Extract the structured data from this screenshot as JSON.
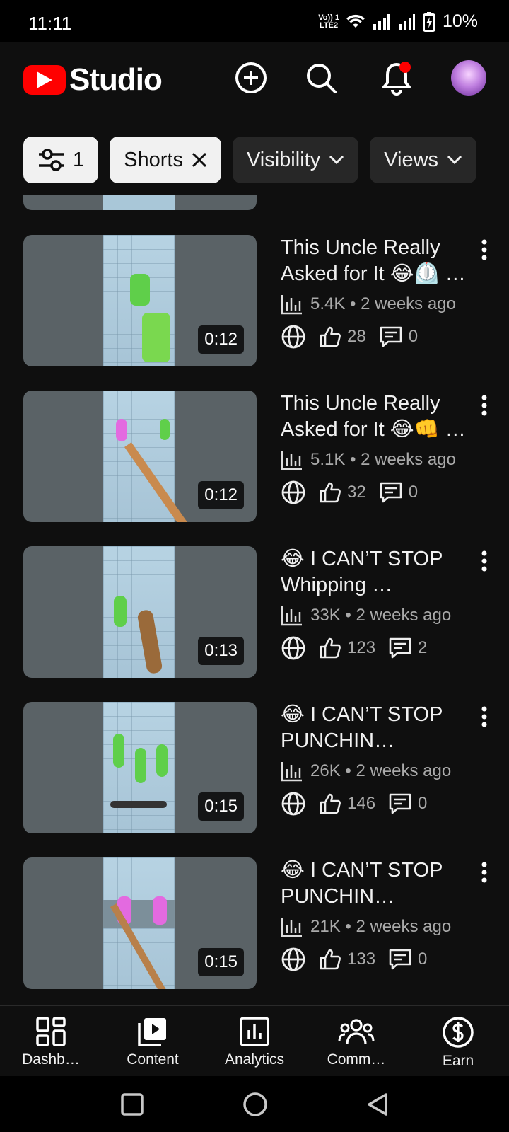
{
  "status_bar": {
    "time": "11:11",
    "volte_top": "Vo)) 1",
    "volte_bottom": "LTE2",
    "battery": "10%"
  },
  "header": {
    "logo_text": "Studio"
  },
  "filters": {
    "count": "1",
    "chips": [
      {
        "label": "Shorts"
      },
      {
        "label": "Visibility"
      },
      {
        "label": "Views"
      }
    ]
  },
  "videos": [
    {
      "title": "This Uncle Really Asked for It 😂⏲️ …",
      "views": "5.4K",
      "age": "• 2 weeks ago",
      "likes": "28",
      "comments": "0",
      "duration": "0:12"
    },
    {
      "title": "This Uncle Really Asked for It 😂👊 …",
      "views": "5.1K",
      "age": "• 2 weeks ago",
      "likes": "32",
      "comments": "0",
      "duration": "0:12"
    },
    {
      "title": "😂 I CAN’T STOP Whipping …",
      "views": "33K",
      "age": "• 2 weeks ago",
      "likes": "123",
      "comments": "2",
      "duration": "0:13"
    },
    {
      "title": "😂 I CAN’T STOP PUNCHIN…",
      "views": "26K",
      "age": "• 2 weeks ago",
      "likes": "146",
      "comments": "0",
      "duration": "0:15"
    },
    {
      "title": "😂 I CAN’T STOP PUNCHIN…",
      "views": "21K",
      "age": "• 2 weeks ago",
      "likes": "133",
      "comments": "0",
      "duration": "0:15"
    }
  ],
  "bottom_nav": [
    {
      "label": "Dashb…",
      "icon": "dashboard-icon"
    },
    {
      "label": "Content",
      "icon": "content-icon"
    },
    {
      "label": "Analytics",
      "icon": "analytics-icon"
    },
    {
      "label": "Comm…",
      "icon": "community-icon"
    },
    {
      "label": "Earn",
      "icon": "earn-icon"
    }
  ],
  "colors": {
    "brand_red": "#ff0000",
    "background": "#0f0f0f",
    "chip_dark": "#272727",
    "notification_dot": "#ff0000"
  }
}
